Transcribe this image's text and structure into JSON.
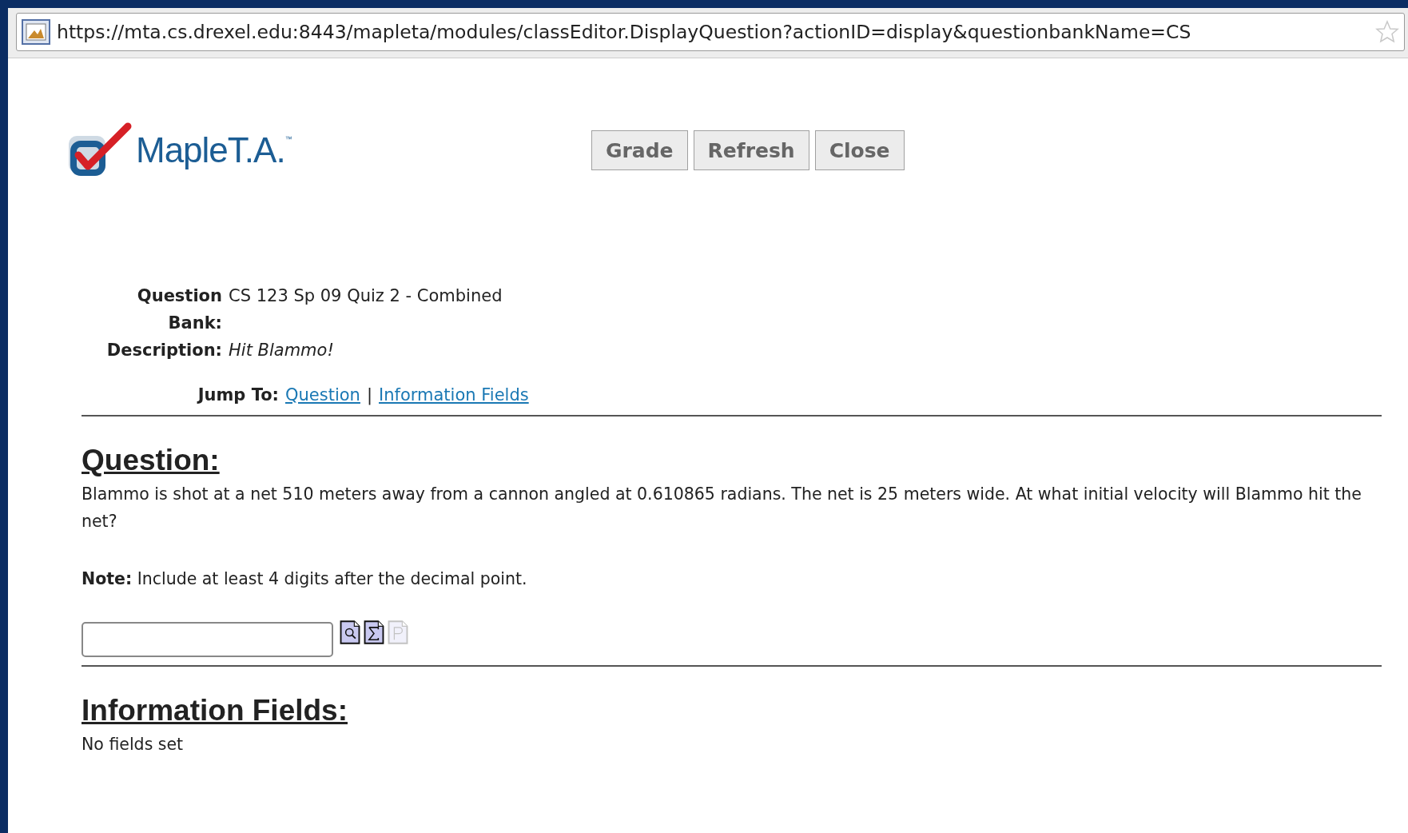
{
  "address_bar": {
    "url": "https://mta.cs.drexel.edu:8443/mapleta/modules/classEditor.DisplayQuestion?actionID=display&questionbankName=CS"
  },
  "logo": {
    "name": "Maple",
    "suffix": "T.A.",
    "mark": "™"
  },
  "buttons": [
    "Grade",
    "Refresh",
    "Close"
  ],
  "details": [
    {
      "label": "Question Bank:",
      "value": "CS 123 Sp 09 Quiz 2 - Combined",
      "kind": "plain"
    },
    {
      "label": "Description:",
      "value": "Hit Blammo!",
      "kind": "italic"
    }
  ],
  "jump": {
    "label": "Jump To:",
    "links": [
      "Question",
      "Information Fields"
    ],
    "separator": "|"
  },
  "question": {
    "heading": "Question:",
    "text": "Blammo is shot at a net 510 meters away from a cannon angled at 0.610865 radians. The net is 25 meters wide. At what initial velocity will Blammo hit the net?",
    "note": "**Note:** Include at least 4 digits after the decimal point.",
    "tools": [
      {
        "kind": "preview",
        "disabled": false
      },
      {
        "kind": "equation",
        "disabled": false
      },
      {
        "kind": "plot",
        "disabled": true
      }
    ]
  },
  "information": {
    "heading": "Information Fields:",
    "text": "No fields set"
  }
}
